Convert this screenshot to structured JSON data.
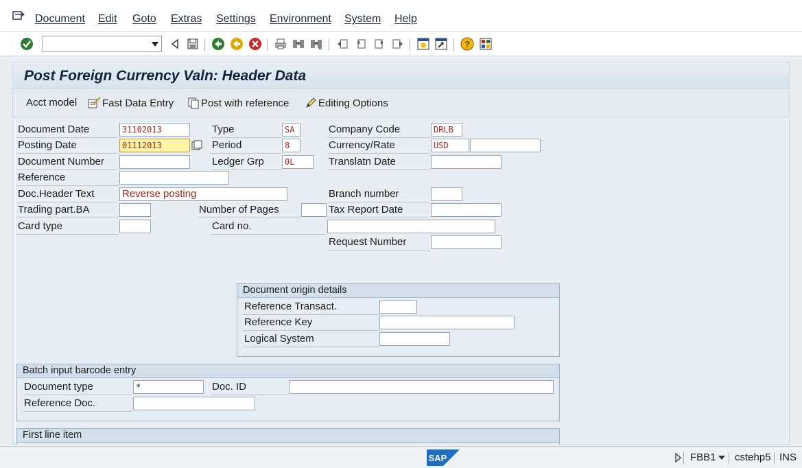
{
  "menu": {
    "items": [
      "Document",
      "Edit",
      "Goto",
      "Extras",
      "Settings",
      "Environment",
      "System",
      "Help"
    ]
  },
  "toolbar": {
    "command_value": "",
    "icons": [
      "enter-icon",
      "back-nav-icon",
      "save-icon",
      "back-icon",
      "exit-icon",
      "cancel-icon",
      "print-icon",
      "find-icon",
      "find-next-icon",
      "first-page-icon",
      "prev-page-icon",
      "next-page-icon",
      "last-page-icon",
      "new-session-icon",
      "shortcut-icon",
      "help-icon",
      "layout-icon"
    ]
  },
  "title": "Post Foreign Currency Valn: Header Data",
  "app_toolbar": {
    "acct_model": "Acct model",
    "fast_entry": "Fast Data Entry",
    "post_ref": "Post with reference",
    "editing": "Editing Options"
  },
  "header": {
    "doc_date_label": "Document Date",
    "doc_date": "31102013",
    "type_label": "Type",
    "type": "SA",
    "company_code_label": "Company Code",
    "company_code": "DRLB",
    "posting_date_label": "Posting Date",
    "posting_date": "01112013",
    "period_label": "Period",
    "period": "8",
    "currency_label": "Currency/Rate",
    "currency": "USD",
    "rate": "",
    "doc_number_label": "Document Number",
    "doc_number": "",
    "ledger_grp_label": "Ledger Grp",
    "ledger_grp": "0L",
    "translatn_date_label": "Translatn Date",
    "translatn_date": "",
    "reference_label": "Reference",
    "reference": "",
    "doc_header_text_label": "Doc.Header Text",
    "doc_header_text": "Reverse posting",
    "branch_label": "Branch number",
    "branch": "",
    "trading_part_label": "Trading part.BA",
    "trading_part": "",
    "num_pages_label": "Number of Pages",
    "num_pages": "",
    "tax_report_label": "Tax Report Date",
    "tax_report": "",
    "card_type_label": "Card type",
    "card_type": "",
    "card_no_label": "Card no.",
    "card_no": "",
    "request_number_label": "Request Number",
    "request_number": ""
  },
  "origin": {
    "title": "Document origin details",
    "ref_transact_label": "Reference Transact.",
    "ref_transact": "",
    "ref_key_label": "Reference Key",
    "ref_key": "",
    "logical_system_label": "Logical System",
    "logical_system": ""
  },
  "barcode": {
    "title": "Batch input barcode entry",
    "doc_type_label": "Document type",
    "doc_type": "*",
    "doc_id_label": "Doc. ID",
    "doc_id": "",
    "ref_doc_label": "Reference Doc.",
    "ref_doc": ""
  },
  "first_line": {
    "title": "First line item"
  },
  "status": {
    "logo": "SAP",
    "transaction": "FBB1",
    "server": "cstehp5",
    "mode": "INS"
  }
}
